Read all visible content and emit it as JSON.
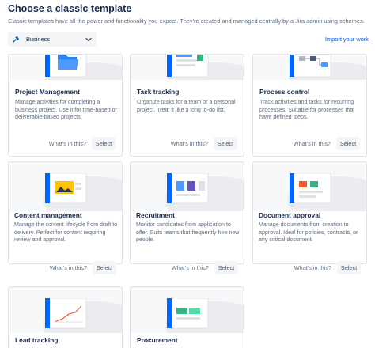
{
  "header": {
    "title": "Choose a classic template",
    "subtitle": "Classic templates have all the power and functionality you expect. They're created and managed centrally by a Jira admin using schemes."
  },
  "project_select": {
    "value": "Business",
    "icon": "pin-icon"
  },
  "import_link": "Import your work",
  "colors": {
    "brand_blue": "#0052cc",
    "hero_blue": "#0065ff",
    "card_border": "#dfe1e6",
    "button_bg": "#f4f5f7"
  },
  "templates": [
    {
      "title": "Project Management",
      "description": "Manage activities for completing a business project. Use it for time-based or deliverable-based projects.",
      "whats": "What's in this?",
      "select": "Select",
      "illustration": "folder-illustration"
    },
    {
      "title": "Task tracking",
      "description": "Organize tasks for a team or a personal project. Treat it like a long to-do list.",
      "whats": "What's in this?",
      "select": "Select",
      "illustration": "task-board-illustration"
    },
    {
      "title": "Process control",
      "description": "Track activities and tasks for recurring processes. Suitable for processes that have defined steps.",
      "whats": "What's in this?",
      "select": "Select",
      "illustration": "process-flow-illustration"
    },
    {
      "title": "Content management",
      "description": "Manage the content lifecycle from draft to delivery. Perfect for content requiring review and approval.",
      "whats": "What's in this?",
      "select": "Select",
      "illustration": "content-illustration"
    },
    {
      "title": "Recruitment",
      "description": "Monitor candidates from application to offer. Suits teams that frequently hire new people.",
      "whats": "What's in this?",
      "select": "Select",
      "illustration": "candidates-illustration"
    },
    {
      "title": "Document approval",
      "description": "Manage documents from creation to approval. Ideal for policies, contracts, or any critical document.",
      "whats": "What's in this?",
      "select": "Select",
      "illustration": "document-illustration"
    },
    {
      "title": "Lead tracking",
      "illustration": "chart-illustration"
    },
    {
      "title": "Procurement",
      "illustration": "procurement-illustration"
    }
  ]
}
